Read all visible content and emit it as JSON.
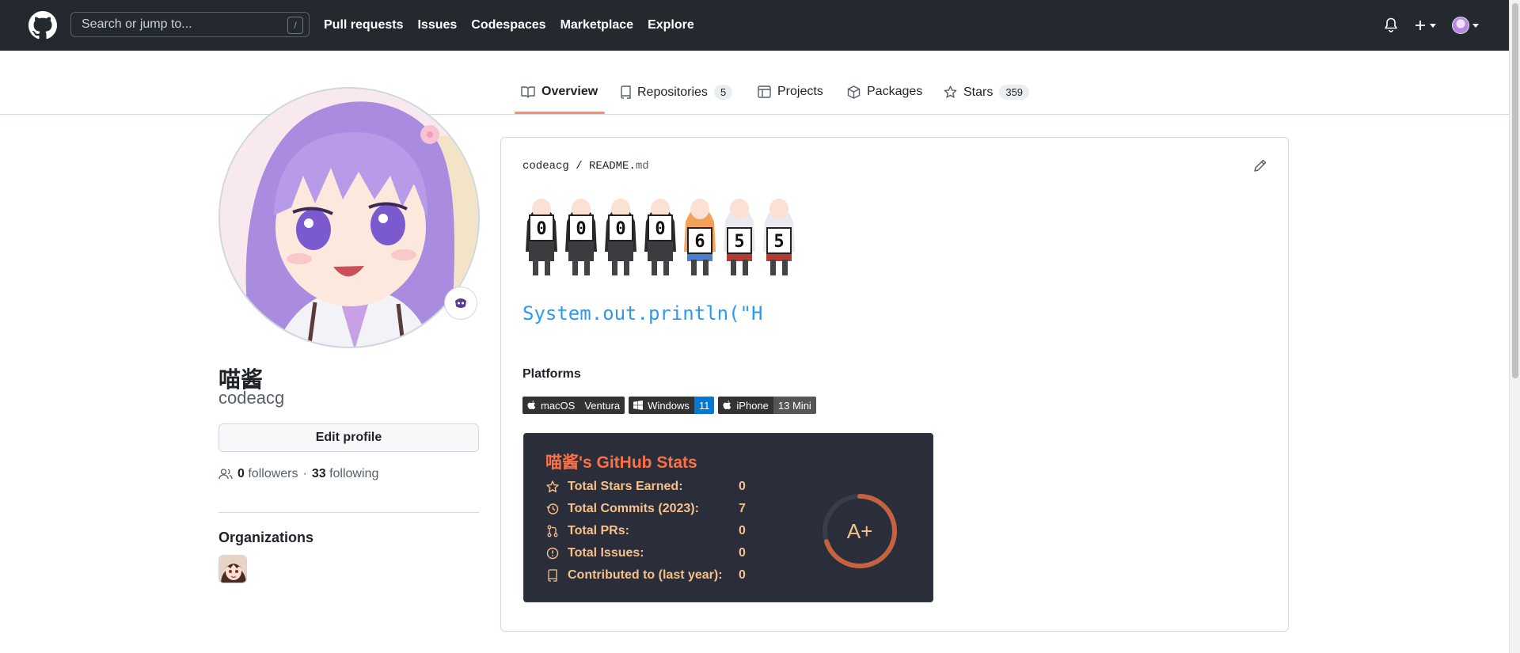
{
  "header": {
    "search_placeholder": "Search or jump to...",
    "search_shortcut": "/",
    "nav": [
      "Pull requests",
      "Issues",
      "Codespaces",
      "Marketplace",
      "Explore"
    ]
  },
  "tabs": {
    "overview": "Overview",
    "repositories": "Repositories",
    "repositories_count": "5",
    "projects": "Projects",
    "packages": "Packages",
    "stars": "Stars",
    "stars_count": "359"
  },
  "profile": {
    "name": "喵酱",
    "login": "codeacg",
    "edit_label": "Edit profile",
    "followers_count": "0",
    "followers_label": "followers",
    "separator": "·",
    "following_count": "33",
    "following_label": "following",
    "orgs_title": "Organizations"
  },
  "readme": {
    "owner": "codeacg",
    "sep": "/",
    "file": "README.",
    "ext": "md",
    "counter_digits": [
      "0",
      "0",
      "0",
      "0",
      "6",
      "5",
      "5"
    ],
    "println": "System.out.println(\"H",
    "platforms_title": "Platforms",
    "badges": [
      {
        "left": "macOS",
        "right": "Ventura",
        "color": "#333333",
        "icon": "apple-icon"
      },
      {
        "left": "Windows",
        "right": "11",
        "color": "#0078d6",
        "icon": "windows-icon"
      },
      {
        "left": "iPhone",
        "right": "13 Mini",
        "color": "#555555",
        "icon": "apple-icon"
      }
    ]
  },
  "stats": {
    "title": "喵酱's GitHub Stats",
    "rows": [
      {
        "label": "Total Stars Earned:",
        "value": "0",
        "icon": "star-icon"
      },
      {
        "label": "Total Commits (2023):",
        "value": "7",
        "icon": "history-icon"
      },
      {
        "label": "Total PRs:",
        "value": "0",
        "icon": "pull-request-icon"
      },
      {
        "label": "Total Issues:",
        "value": "0",
        "icon": "issue-icon"
      },
      {
        "label": "Contributed to (last year):",
        "value": "0",
        "icon": "repo-icon"
      }
    ],
    "rank": "A+",
    "rank_progress": 0.7,
    "colors": {
      "title": "#fe6f42",
      "text": "#f6c08b",
      "bg": "#2a2e3a",
      "ring": "#c5623f"
    }
  }
}
